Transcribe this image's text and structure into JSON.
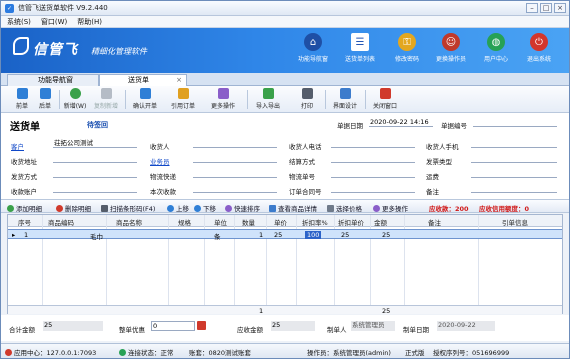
{
  "window": {
    "title": "信管飞送货单软件 V9.2.440"
  },
  "menu": [
    "系统(S)",
    "窗口(W)",
    "帮助(H)"
  ],
  "banner": {
    "logo": "信管飞",
    "slogan": "精细化管理软件",
    "buttons": [
      {
        "label": "功能导航窗",
        "color": "#1e4fa5",
        "icon": "home-icon"
      },
      {
        "label": "送货单列表",
        "color": "#2456b4",
        "icon": "list-icon"
      },
      {
        "label": "修改密码",
        "color": "#e3a720",
        "icon": "key-icon"
      },
      {
        "label": "更换操作员",
        "color": "#c0392b",
        "icon": "users-icon"
      },
      {
        "label": "用户中心",
        "color": "#27a155",
        "icon": "globe-icon"
      },
      {
        "label": "退出系统",
        "color": "#d3362c",
        "icon": "power-icon"
      }
    ]
  },
  "tabs": [
    {
      "label": "功能导航窗"
    },
    {
      "label": "送货单"
    }
  ],
  "toolbar": [
    {
      "label": "前单",
      "color": "#2f7fd6"
    },
    {
      "label": "后单",
      "color": "#2f7fd6"
    },
    {
      "label": "新增(W)",
      "color": "#3aa14a"
    },
    {
      "label": "复制新增",
      "color": "#b5bcc6"
    },
    {
      "label": "确认开单",
      "color": "#2f7fd6"
    },
    {
      "label": "引用订单",
      "color": "#e0a020"
    },
    {
      "label": "更多操作",
      "color": "#8a5ec9"
    },
    {
      "label": "导入导出",
      "color": "#3aa14a"
    },
    {
      "label": "打印",
      "color": "#555d6b"
    },
    {
      "label": "界面设计",
      "color": "#3d7ccc"
    },
    {
      "label": "关闭窗口",
      "color": "#d03a2c"
    }
  ],
  "form": {
    "title": "送货单",
    "status": "待签回",
    "date_label": "单据日期",
    "date": "2020-09-22 14:16",
    "no_label": "单据编号",
    "no": "",
    "fields": [
      {
        "label": "客户",
        "value": "荘拓公司测试"
      },
      {
        "label": "收货人",
        "value": ""
      },
      {
        "label": "收货人电话",
        "value": ""
      },
      {
        "label": "收货人手机",
        "value": ""
      },
      {
        "label": "收货地址",
        "value": ""
      },
      {
        "label": "业务员",
        "value": ""
      },
      {
        "label": "结算方式",
        "value": ""
      },
      {
        "label": "发票类型",
        "value": ""
      },
      {
        "label": "发货方式",
        "value": ""
      },
      {
        "label": "物流快递",
        "value": ""
      },
      {
        "label": "物流单号",
        "value": ""
      },
      {
        "label": "运费",
        "value": ""
      },
      {
        "label": "收款账户",
        "value": ""
      },
      {
        "label": "本次收款",
        "value": ""
      },
      {
        "label": "订单合同号",
        "value": ""
      },
      {
        "label": "备注",
        "value": ""
      }
    ]
  },
  "gridbar": {
    "add": "添加明细",
    "delete": "删除明细",
    "scan": "扫描条形码(F4)",
    "up": "上移",
    "down": "下移",
    "sort": "快速排序",
    "view": "查看商品详情",
    "price": "选择价格",
    "more": "更多操作",
    "receivable": "应收款：200",
    "credit": "应收信用额度：0"
  },
  "grid": {
    "headers": [
      "序号",
      "商品编码",
      "商品名称",
      "规格",
      "单位",
      "数量",
      "单价",
      "折扣率%",
      "折扣单价",
      "金额",
      "备注",
      "引单信息"
    ],
    "rows": [
      {
        "no": "1",
        "code": "",
        "name": "毛巾",
        "spec": "",
        "unit": "条",
        "qty": "1",
        "price": "25",
        "discount": "100",
        "disc_price": "25",
        "amount": "25",
        "memo": "",
        "ref": ""
      }
    ],
    "footer_qty": "1",
    "footer_amount": "25"
  },
  "summary": {
    "total_label": "合计金额",
    "total": "25",
    "discount_label": "整单优惠",
    "discount": "0",
    "receivable_label": "应收金额",
    "receivable": "25",
    "maker_label": "制单人",
    "maker": "系统管理员",
    "make_date_label": "制单日期",
    "make_date": "2020-09-22"
  },
  "status": {
    "server": "应用中心：127.0.0.1:7093",
    "conn": "连接状态：正常",
    "account": "账套：0820测试账套",
    "operator": "操作员：系统管理员(admin)",
    "version": "正式版",
    "serial": "授权序列号：051696999"
  }
}
